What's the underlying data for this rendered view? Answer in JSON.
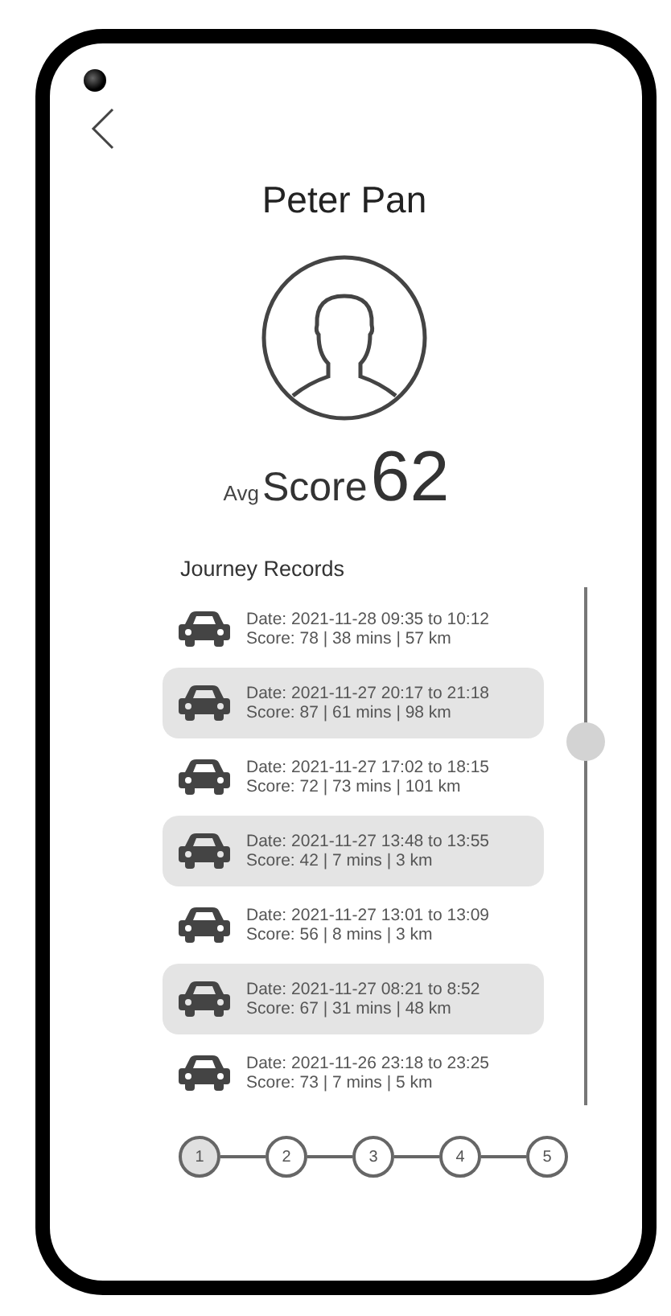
{
  "user": {
    "name": "Peter Pan"
  },
  "score": {
    "prefix": "Avg",
    "label": "Score",
    "value": "62"
  },
  "journeys": {
    "title": "Journey Records",
    "records": [
      {
        "date": "Date: 2021-11-28 09:35 to 10:12",
        "summary": "Score: 78 | 38 mins | 57 km",
        "highlighted": false
      },
      {
        "date": "Date: 2021-11-27 20:17 to 21:18",
        "summary": "Score: 87 | 61 mins | 98 km",
        "highlighted": true
      },
      {
        "date": "Date: 2021-11-27 17:02 to 18:15",
        "summary": "Score: 72 | 73 mins | 101 km",
        "highlighted": false
      },
      {
        "date": "Date: 2021-11-27 13:48 to 13:55",
        "summary": "Score: 42 | 7 mins | 3 km",
        "highlighted": true
      },
      {
        "date": "Date: 2021-11-27 13:01 to 13:09",
        "summary": "Score: 56 | 8 mins | 3 km",
        "highlighted": false
      },
      {
        "date": "Date: 2021-11-27 08:21 to 8:52",
        "summary": "Score: 67 | 31 mins | 48 km",
        "highlighted": true
      },
      {
        "date": "Date: 2021-11-26 23:18 to 23:25",
        "summary": "Score: 73 | 7 mins | 5 km",
        "highlighted": false
      }
    ]
  },
  "pagination": [
    {
      "label": "1",
      "selected": true
    },
    {
      "label": "2",
      "selected": false
    },
    {
      "label": "3",
      "selected": false
    },
    {
      "label": "4",
      "selected": false
    },
    {
      "label": "5",
      "selected": false
    }
  ]
}
